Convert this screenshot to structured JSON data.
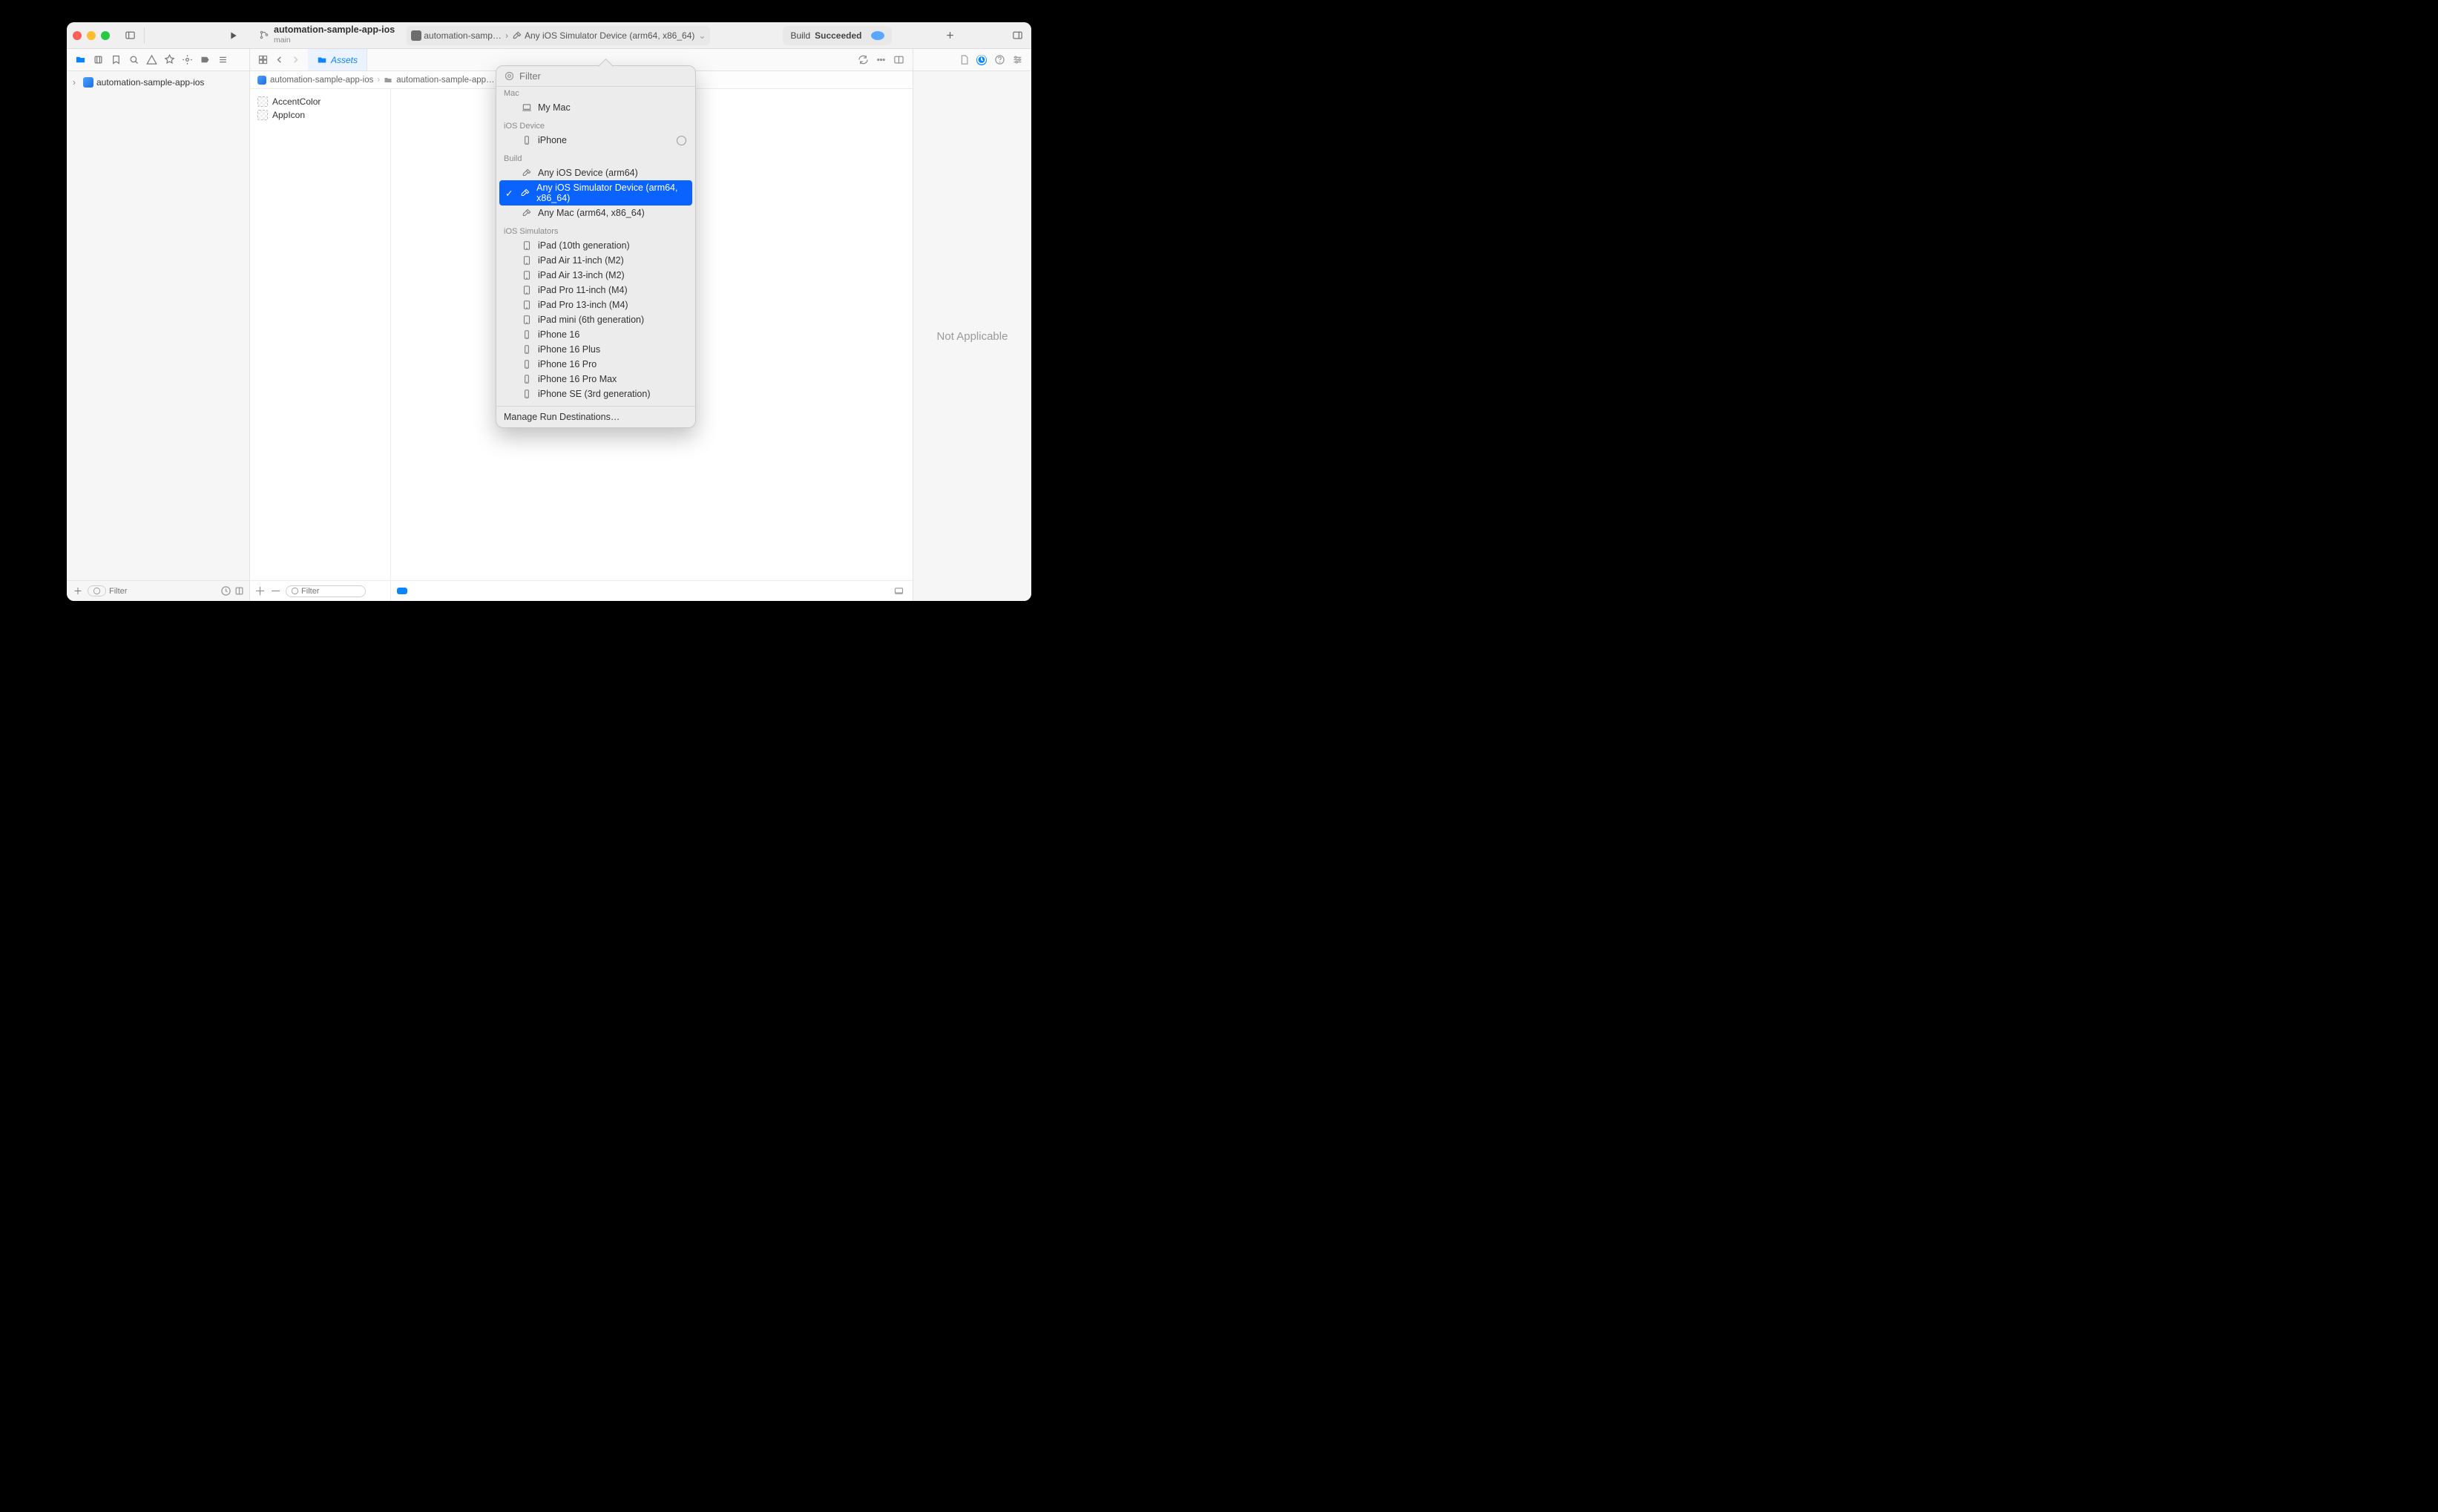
{
  "toolbar": {
    "project_name": "automation-sample-app-ios",
    "branch": "main",
    "scheme_app": "automation-samp…",
    "destination": "Any iOS Simulator Device (arm64, x86_64)",
    "build_prefix": "Build",
    "build_status": "Succeeded"
  },
  "tabs": {
    "active": "Assets"
  },
  "breadcrumb": {
    "root": "automation-sample-app-ios",
    "folder": "automation-sample-app…"
  },
  "navigator": {
    "root_item": "automation-sample-app-ios",
    "filter_placeholder": "Filter"
  },
  "assets": {
    "items": [
      "AccentColor",
      "AppIcon"
    ],
    "filter_placeholder": "Filter"
  },
  "inspector": {
    "message": "Not Applicable"
  },
  "popover": {
    "filter_placeholder": "Filter",
    "sections": {
      "mac": {
        "label": "Mac",
        "items": [
          {
            "label": "My Mac",
            "icon": "laptop"
          }
        ]
      },
      "ios_device": {
        "label": "iOS Device",
        "items": [
          {
            "label": "iPhone",
            "icon": "iphone",
            "globe": true
          }
        ]
      },
      "build": {
        "label": "Build",
        "items": [
          {
            "label": "Any iOS Device (arm64)",
            "icon": "hammer"
          },
          {
            "label": "Any iOS Simulator Device (arm64, x86_64)",
            "icon": "hammer",
            "selected": true
          },
          {
            "label": "Any Mac (arm64, x86_64)",
            "icon": "hammer"
          }
        ]
      },
      "simulators": {
        "label": "iOS Simulators",
        "items": [
          {
            "label": "iPad (10th generation)",
            "icon": "ipad"
          },
          {
            "label": "iPad Air 11-inch (M2)",
            "icon": "ipad"
          },
          {
            "label": "iPad Air 13-inch (M2)",
            "icon": "ipad"
          },
          {
            "label": "iPad Pro 11-inch (M4)",
            "icon": "ipad"
          },
          {
            "label": "iPad Pro 13-inch (M4)",
            "icon": "ipad"
          },
          {
            "label": "iPad mini (6th generation)",
            "icon": "ipad"
          },
          {
            "label": "iPhone 16",
            "icon": "iphone"
          },
          {
            "label": "iPhone 16 Plus",
            "icon": "iphone"
          },
          {
            "label": "iPhone 16 Pro",
            "icon": "iphone"
          },
          {
            "label": "iPhone 16 Pro Max",
            "icon": "iphone"
          },
          {
            "label": "iPhone SE (3rd generation)",
            "icon": "iphone"
          }
        ]
      }
    },
    "footer": "Manage Run Destinations…"
  }
}
